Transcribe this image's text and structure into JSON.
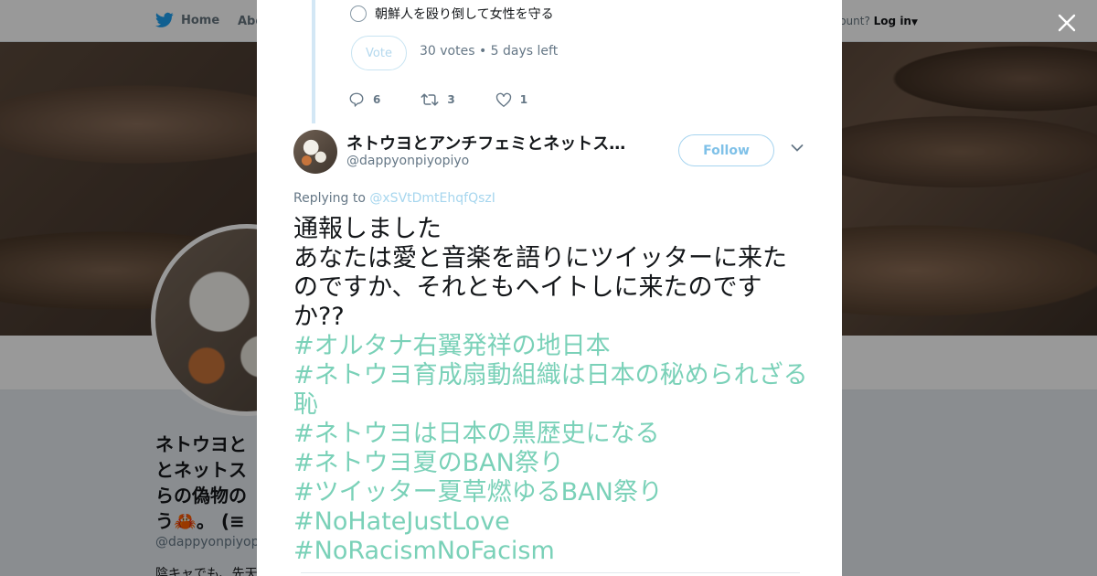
{
  "nav": {
    "home": "Home",
    "about": "Abo",
    "account_prompt": "ccount?",
    "login": "Log in"
  },
  "profile": {
    "name": "ネトウヨと\nとネットス\nらの偽物の\nう🦀。 (≡",
    "handle": "@dappyonpiyopiyo",
    "bio": "陰キャでも、先天"
  },
  "poll": {
    "option": "朝鮮人を殴り倒して女性を守る",
    "vote_label": "Vote",
    "meta": "30 votes • 5 days left"
  },
  "actions": {
    "replies": "6",
    "retweets": "3",
    "likes": "1"
  },
  "tweet": {
    "author_name": "ネトウヨとアンチフェミとネットス…",
    "author_handle": "@dappyonpiyopiyo",
    "follow_label": "Follow",
    "replying_prefix": "Replying to ",
    "replying_to": "@xSVtDmtEhqfQszI",
    "text_lines": [
      "通報しました",
      "あなたは愛と音楽を語りにツイッターに来たのですか、それともヘイトしに来たのですか??"
    ],
    "hashtags": [
      "#オルタナ右翼発祥の地日本",
      "#ネトウヨ育成扇動組織は日本の秘められざる恥",
      "#ネトウヨは日本の黒歴史になる",
      "#ネトウヨ夏のBAN祭り",
      "#ツイッター夏草燃ゆるBAN祭り",
      "#NoHateJustLove",
      "#NoRacismNoFacism"
    ]
  },
  "colors": {
    "twitter_blue": "#1da1f2",
    "hashtag": "#7ad1b8",
    "text": "#14171a",
    "muted": "#657786"
  }
}
